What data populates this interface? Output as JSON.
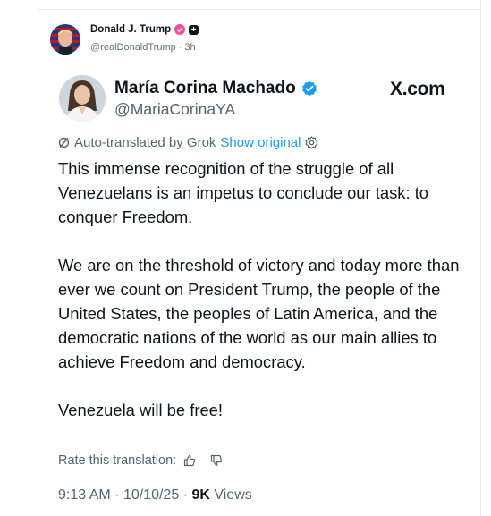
{
  "post": {
    "author_name": "Donald J. Trump",
    "author_handle": "@realDonaldTrump",
    "separator": "·",
    "time_ago": "3h",
    "badge_box_glyph": "+"
  },
  "quote": {
    "author_name": "María Corina Machado",
    "author_handle": "@MariaCorinaYA",
    "site": "X.com",
    "translation_note": "Auto-translated by Grok",
    "show_original": "Show original",
    "paragraphs": [
      "This immense recognition of the struggle of all Venezuelans is an impetus to conclude our task: to conquer Freedom.",
      "We are on the threshold of victory and today more than ever we count on President Trump, the people of the United States, the peoples of Latin America, and the democratic nations of the world as our main allies to achieve Freedom and democracy.",
      "Venezuela will be free!"
    ],
    "rate_label": "Rate this translation:",
    "time": "9:13 AM",
    "date": "10/10/25",
    "views_count": "9K",
    "views_label": "Views",
    "meta_separator": "·"
  },
  "colors": {
    "verified_blue": "#1d9bf0",
    "pink_badge": "#f0509c",
    "muted_text": "#536471"
  }
}
